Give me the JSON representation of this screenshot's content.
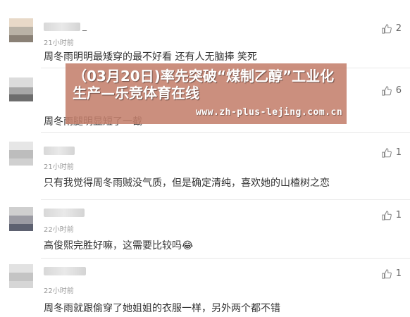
{
  "comments": [
    {
      "name_suffix": "_",
      "time": "21小时前",
      "text": "周冬雨明明最矮穿的最不好看 还有人无脑捧 笑死",
      "likes": "2"
    },
    {
      "name_suffix": "",
      "time": "",
      "text": "周冬雨腿明显短了一截",
      "likes": "6"
    },
    {
      "name_suffix": "",
      "time": "21小时前",
      "text": "只有我觉得周冬雨贼没气质，但是确定清纯，喜欢她的山楂树之恋",
      "likes": "1"
    },
    {
      "name_suffix": "",
      "time": "22小时前",
      "text": "高俊熙完胜好嘛，这需要比较吗😂",
      "likes": "1"
    },
    {
      "name_suffix": "",
      "time": "22小时前",
      "text": "周冬雨就跟偷穿了她姐姐的衣服一样，另外两个都不错",
      "likes": "1"
    }
  ],
  "banner": {
    "title": "（03月20日)率先突破“煤制乙醇”工业化生产—乐竞体育在线",
    "url": "www.zh-plus-lejing.com.cn"
  },
  "icons": {
    "like": "thumbs-up-icon"
  },
  "colors": {
    "banner_bg": "#c4806c",
    "text": "#333333",
    "meta": "#999999"
  }
}
